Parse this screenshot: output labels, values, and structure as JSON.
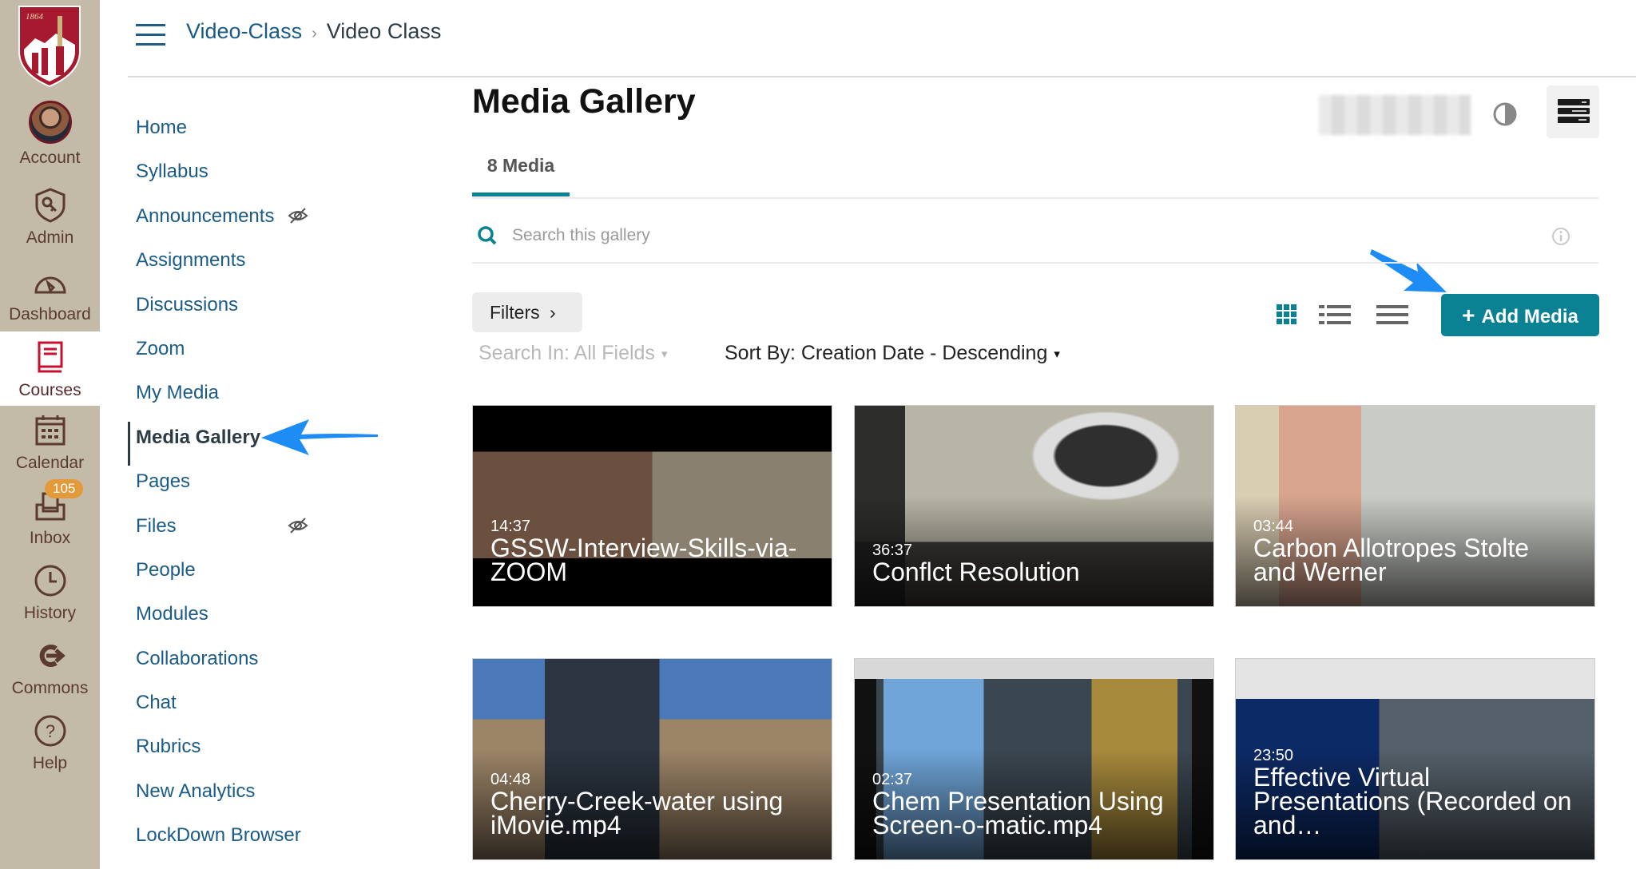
{
  "global_nav": {
    "logo_text": "1864",
    "items": [
      {
        "label": "Account",
        "icon": "avatar"
      },
      {
        "label": "Admin",
        "icon": "shield-key-icon"
      },
      {
        "label": "Dashboard",
        "icon": "speedometer-icon"
      },
      {
        "label": "Courses",
        "icon": "book-icon",
        "active": true
      },
      {
        "label": "Calendar",
        "icon": "calendar-icon"
      },
      {
        "label": "Inbox",
        "icon": "inbox-icon",
        "badge": "105"
      },
      {
        "label": "History",
        "icon": "clock-icon"
      },
      {
        "label": "Commons",
        "icon": "commons-arrow-icon"
      },
      {
        "label": "Help",
        "icon": "question-icon"
      }
    ]
  },
  "breadcrumb": {
    "items": [
      "Video-Class",
      "Video Class"
    ],
    "separator": "›"
  },
  "course_nav": {
    "items": [
      {
        "label": "Home"
      },
      {
        "label": "Syllabus"
      },
      {
        "label": "Announcements",
        "hidden_icon": true
      },
      {
        "label": "Assignments"
      },
      {
        "label": "Discussions"
      },
      {
        "label": "Zoom"
      },
      {
        "label": "My Media"
      },
      {
        "label": "Media Gallery",
        "active": true
      },
      {
        "label": "Pages"
      },
      {
        "label": "Files",
        "hidden_icon": true
      },
      {
        "label": "People"
      },
      {
        "label": "Modules"
      },
      {
        "label": "Collaborations"
      },
      {
        "label": "Chat"
      },
      {
        "label": "Rubrics"
      },
      {
        "label": "New Analytics"
      },
      {
        "label": "LockDown Browser"
      }
    ]
  },
  "main": {
    "title": "Media Gallery",
    "tab_label": "8 Media",
    "search_placeholder": "Search this gallery",
    "filters_label": "Filters",
    "filters_chevron": "›",
    "search_in": "Search In: All Fields",
    "sort_by": "Sort By: Creation Date - Descending",
    "chevron_down": "⌄",
    "add_media_label": "Add Media",
    "add_media_plus": "+",
    "accent_color": "#0a8293"
  },
  "media": [
    {
      "duration": "14:37",
      "title": "GSSW-Interview-Skills-via-ZOOM"
    },
    {
      "duration": "36:37",
      "title": "Conflct Resolution"
    },
    {
      "duration": "03:44",
      "title": "Carbon Allotropes Stolte and Werner"
    },
    {
      "duration": "04:48",
      "title": "Cherry-Creek-water using iMovie.mp4"
    },
    {
      "duration": "02:37",
      "title": "Chem Presentation Using Screen-o-matic.mp4"
    },
    {
      "duration": "23:50",
      "title": "Effective Virtual Presentations (Recorded on and…"
    }
  ]
}
